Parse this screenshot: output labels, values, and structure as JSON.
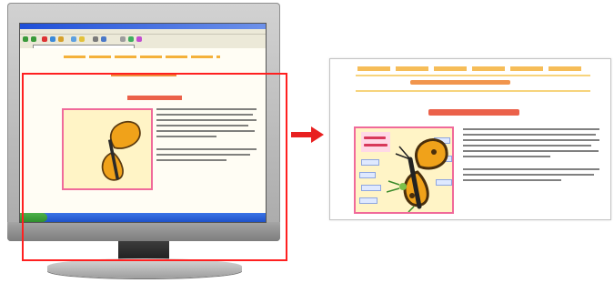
{
  "illustration": {
    "monitor": {
      "icon": "lcd-monitor-icon"
    },
    "crop_frame": {
      "color": "#ff2020"
    },
    "arrow": {
      "icon": "arrow-right-icon",
      "color": "#e82020"
    },
    "page": {
      "accent_heading": "#e8452a",
      "accent_nav": "#f4b13a",
      "diagram_border": "#f06a9a",
      "diagram_fill": "#fff4c6"
    }
  }
}
